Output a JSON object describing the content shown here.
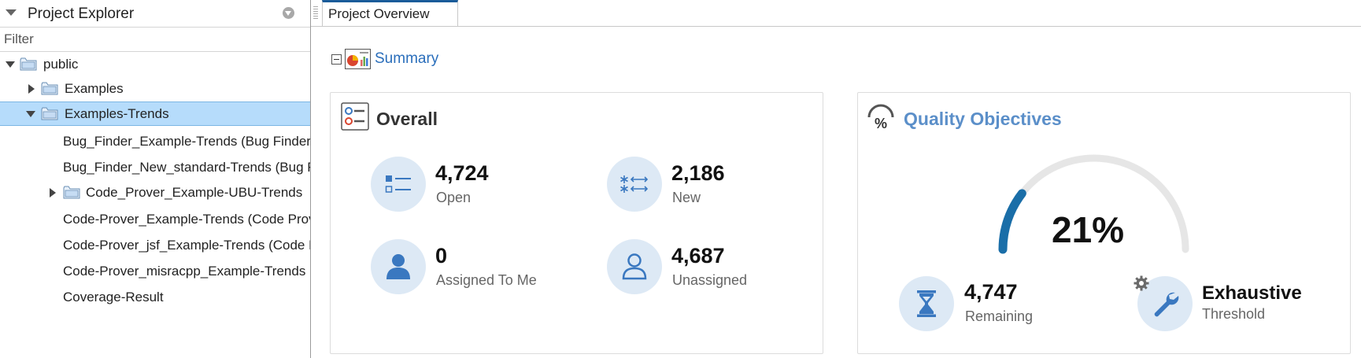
{
  "explorer": {
    "title": "Project Explorer",
    "filter_placeholder": "Filter",
    "tree": [
      {
        "label": "public"
      },
      {
        "label": "Examples"
      },
      {
        "label": "Examples-Trends"
      },
      {
        "label": "Bug_Finder_Example-Trends (Bug Finder)"
      },
      {
        "label": "Bug_Finder_New_standard-Trends (Bug Finder)"
      },
      {
        "label": "Code_Prover_Example-UBU-Trends"
      },
      {
        "label": "Code-Prover_Example-Trends (Code Prover)"
      },
      {
        "label": "Code-Prover_jsf_Example-Trends (Code Prover)"
      },
      {
        "label": "Code-Prover_misracpp_Example-Trends"
      },
      {
        "label": "Coverage-Result"
      }
    ]
  },
  "tabs": [
    {
      "label": "Project Overview"
    }
  ],
  "summary": {
    "label": "Summary"
  },
  "overall": {
    "title": "Overall",
    "metrics": [
      {
        "value": "4,724",
        "label": "Open",
        "icon": "list-icon"
      },
      {
        "value": "2,186",
        "label": "New",
        "icon": "new-items-icon"
      },
      {
        "value": "0",
        "label": "Assigned To Me",
        "icon": "user-filled-icon"
      },
      {
        "value": "4,687",
        "label": "Unassigned",
        "icon": "user-outline-icon"
      }
    ]
  },
  "quality": {
    "title": "Quality Objectives",
    "percent": "21%",
    "progress": 0.21,
    "metrics": [
      {
        "value": "4,747",
        "label": "Remaining",
        "icon": "hourglass-icon"
      },
      {
        "value": "Exhaustive",
        "label": "Threshold",
        "icon": "wrench-icon"
      }
    ]
  },
  "colors": {
    "accent": "#1a6ea8",
    "link": "#2a6ebb",
    "icon_bg": "#dde9f5",
    "icon_fg": "#3a78c0",
    "selected_row": "#b6dcfb",
    "gauge_track": "#e6e6e6",
    "quality_title": "#5b8fc9"
  }
}
